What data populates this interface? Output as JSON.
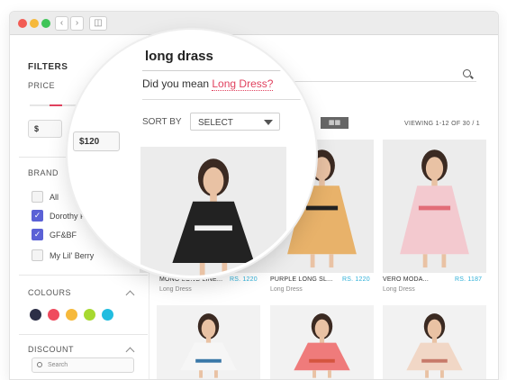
{
  "browser": {
    "dots": [
      "#f25c54",
      "#f6b93b",
      "#3ec457"
    ],
    "back_icon": "chevron-left-icon",
    "forward_icon": "chevron-right-icon",
    "sidebar_icon": "sidebar-icon"
  },
  "sidebar": {
    "filters_label": "FILTERS",
    "price_label": "PRICE",
    "price_min_label": "$",
    "price_max_value": "$120",
    "brand_label": "BRAND",
    "brands": [
      {
        "label": "All",
        "checked": false
      },
      {
        "label": "Dorothy Perkins",
        "checked": true
      },
      {
        "label": "GF&BF",
        "checked": true
      },
      {
        "label": "My Lil' Berry",
        "checked": false
      }
    ],
    "colours_label": "COLOURS",
    "colours": [
      "#2c2f47",
      "#ef4b5e",
      "#f6b93b",
      "#a7d930",
      "#22bde0"
    ],
    "discount_label": "DISCOUNT",
    "discount_search_placeholder": "Search"
  },
  "search": {
    "query": "long drass",
    "suggestion_prefix": "Did you mean ",
    "suggestion": "Long Dress?"
  },
  "toolbar": {
    "sort_label": "SORT BY",
    "sort_value": "SELECT",
    "viewing": "VIEWING 1-12 OF 30 / 1"
  },
  "products": [
    {
      "name": "MONO LONG LINE...",
      "price": "RS. 1220",
      "category": "Long Dress",
      "bg": "#ececec",
      "dress": "#222222",
      "accent": "#f2f2f2"
    },
    {
      "name": "PURPLE LONG SL...",
      "price": "RS. 1220",
      "category": "Long Dress",
      "bg": "#ececec",
      "dress": "#e8b26a",
      "accent": "#222222"
    },
    {
      "name": "VERO MODA...",
      "price": "RS. 1187",
      "category": "Long Dress",
      "bg": "#ececec",
      "dress": "#f3c9cf",
      "accent": "#e26d78"
    },
    {
      "name": "",
      "price": "",
      "category": "",
      "bg": "#f2f2f2",
      "dress": "#f6f6f6",
      "accent": "#3a78a8"
    },
    {
      "name": "",
      "price": "",
      "category": "",
      "bg": "#f2f2f2",
      "dress": "#ef7b7b",
      "accent": "#d5553f"
    },
    {
      "name": "",
      "price": "",
      "category": "",
      "bg": "#f2f2f2",
      "dress": "#f1d7c6",
      "accent": "#c77a6a"
    }
  ]
}
